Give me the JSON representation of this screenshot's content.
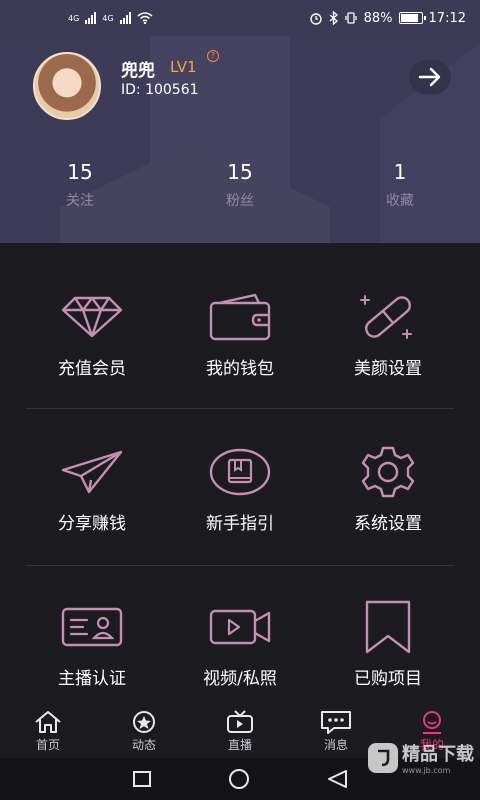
{
  "status_bar": {
    "network_left": "4G",
    "network_right": "4G",
    "battery": "88%",
    "time": "17:12"
  },
  "profile": {
    "name": "兜兜",
    "level": "LV1",
    "level_help": "?",
    "id": "ID: 100561",
    "stats": [
      {
        "value": "15",
        "label": "关注"
      },
      {
        "value": "15",
        "label": "粉丝"
      },
      {
        "value": "1",
        "label": "收藏"
      }
    ]
  },
  "menu": [
    {
      "label": "充值会员",
      "icon": "diamond-icon"
    },
    {
      "label": "我的钱包",
      "icon": "wallet-icon"
    },
    {
      "label": "美颜设置",
      "icon": "beauty-pen-icon"
    },
    {
      "label": "分享赚钱",
      "icon": "paper-plane-icon"
    },
    {
      "label": "新手指引",
      "icon": "guide-book-icon"
    },
    {
      "label": "系统设置",
      "icon": "gear-icon"
    },
    {
      "label": "主播认证",
      "icon": "id-card-icon"
    },
    {
      "label": "视频/私照",
      "icon": "video-camera-icon"
    },
    {
      "label": "已购项目",
      "icon": "bookmark-icon"
    }
  ],
  "tabs": [
    {
      "label": "首页",
      "icon": "home-icon"
    },
    {
      "label": "动态",
      "icon": "star-circle-icon"
    },
    {
      "label": "直播",
      "icon": "tv-icon"
    },
    {
      "label": "消息",
      "icon": "chat-icon"
    },
    {
      "label": "我的",
      "icon": "profile-face-icon",
      "active": true
    }
  ],
  "watermark": {
    "text": "精品下载",
    "sub": "www.jb.com"
  },
  "colors": {
    "header_bg": "#3e3b58",
    "accent": "#e5397c",
    "icon_stroke": "#c48fb0",
    "level": "#f5a63c"
  }
}
